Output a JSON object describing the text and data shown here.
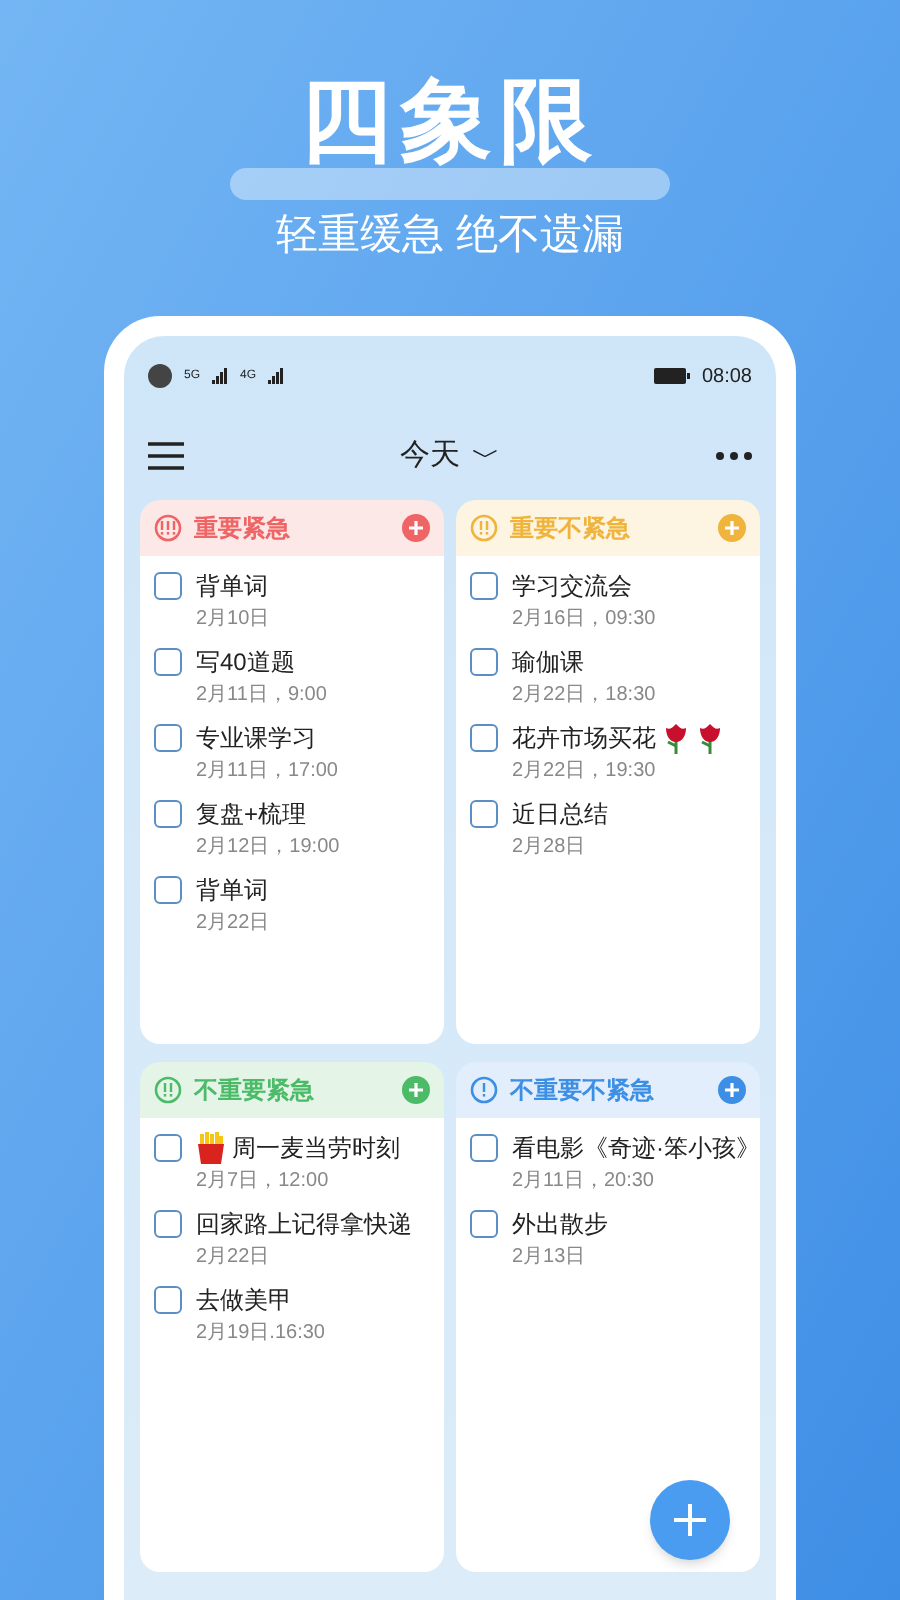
{
  "banner": {
    "title": "四象限",
    "subtitle": "轻重缓急 绝不遗漏"
  },
  "status_bar": {
    "network_1": "5G",
    "network_2": "4G",
    "time": "08:08"
  },
  "header": {
    "title": "今天",
    "dropdown": "﹀"
  },
  "quadrants": [
    {
      "title": "重要紧急",
      "kind": "important-urgent",
      "color": "#ef6464",
      "items": [
        {
          "title": "背单词",
          "date": "2月10日",
          "checked": false
        },
        {
          "title": "写40道题",
          "date": "2月11日，9:00",
          "checked": false
        },
        {
          "title": "专业课学习",
          "date": "2月11日，17:00",
          "checked": false
        },
        {
          "title": "复盘+梳理",
          "date": "2月12日，19:00",
          "checked": false
        },
        {
          "title": "背单词",
          "date": "2月22日",
          "checked": false
        }
      ]
    },
    {
      "title": "重要不紧急",
      "kind": "important",
      "color": "#f0b43c",
      "items": [
        {
          "title": "学习交流会",
          "date": "2月16日，09:30",
          "checked": false
        },
        {
          "title": "瑜伽课",
          "date": "2月22日，18:30",
          "checked": false
        },
        {
          "title": "花卉市场买花",
          "kind": "with-two-roses",
          "date": "2月22日，19:30",
          "checked": false
        },
        {
          "title": "近日总结",
          "date": "2月28日",
          "checked": false
        }
      ]
    },
    {
      "title": "不重要紧急",
      "kind": "urgent",
      "color": "#4cbb68",
      "items": [
        {
          "title": "周一麦当劳时刻",
          "kind": "with-fries",
          "date": "2月7日，12:00",
          "checked": false
        },
        {
          "title": "回家路上记得拿快递",
          "date": "2月22日",
          "checked": false
        },
        {
          "title": "去做美甲",
          "date": "2月19日.16:30",
          "checked": false
        }
      ]
    },
    {
      "title": "不重要不紧急",
      "kind": "neither",
      "color": "#3d8fe6",
      "items": [
        {
          "title": "看电影《奇迹·笨小孩》",
          "date": "2月11日，20:30",
          "checked": false
        },
        {
          "title": "外出散步",
          "date": "2月13日",
          "checked": false
        }
      ]
    }
  ]
}
